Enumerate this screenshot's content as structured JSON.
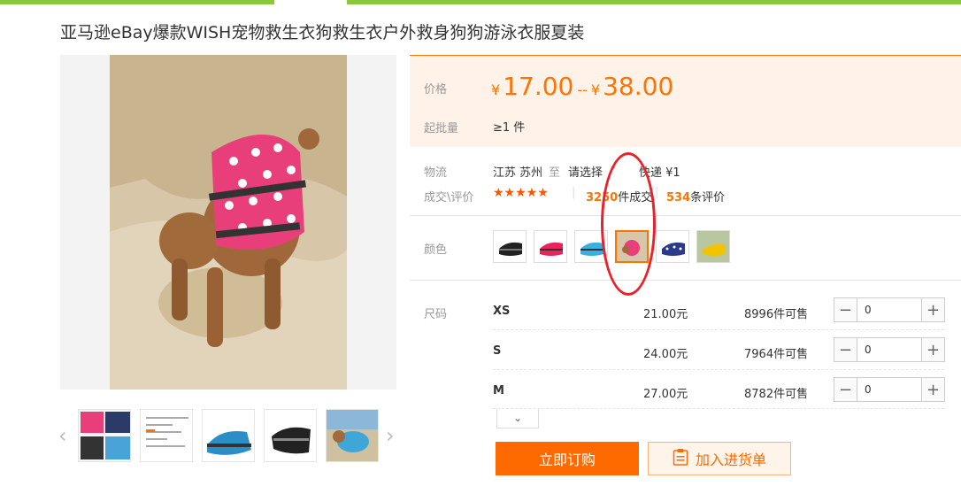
{
  "product": {
    "title": "亚马逊eBay爆款WISH宠物救生衣狗救生衣户外救身狗狗游泳衣服夏装"
  },
  "price": {
    "label": "价格",
    "currency": "¥",
    "min": "17.00",
    "separator": "--",
    "max": "38.00"
  },
  "moq": {
    "label": "起批量",
    "value": "≥1 件"
  },
  "logistics": {
    "label": "物流",
    "from": "江苏 苏州",
    "to_word": "至",
    "destination": "请选择",
    "express": "快递 ¥1"
  },
  "reviews": {
    "label": "成交\\评价",
    "stars": "★★★★★",
    "deals_count": "3250",
    "deals_suffix": "件成交",
    "review_count": "534",
    "review_suffix": "条评价"
  },
  "colors": {
    "label": "颜色",
    "selected_index": 3,
    "swatches": [
      "black-vest",
      "pink-vest",
      "blue-vest",
      "pink-dog-photo",
      "navy-vest",
      "yellow-vest"
    ]
  },
  "sizes": {
    "label": "尺码",
    "rows": [
      {
        "name": "XS",
        "price": "21.00元",
        "stock": "8996件可售",
        "qty": "0"
      },
      {
        "name": "S",
        "price": "24.00元",
        "stock": "7964件可售",
        "qty": "0"
      },
      {
        "name": "M",
        "price": "27.00元",
        "stock": "8782件可售",
        "qty": "0"
      }
    ]
  },
  "actions": {
    "buy_label": "立即订购",
    "cart_label": "加入进货单"
  },
  "icons": {
    "minus": "−",
    "plus": "+",
    "chevron_down": "⌄",
    "arrow_left": "‹",
    "arrow_right": "›"
  },
  "colors_theme": {
    "accent": "#ff7300",
    "green": "#8cc63f",
    "annotation_red": "#e8222a"
  }
}
